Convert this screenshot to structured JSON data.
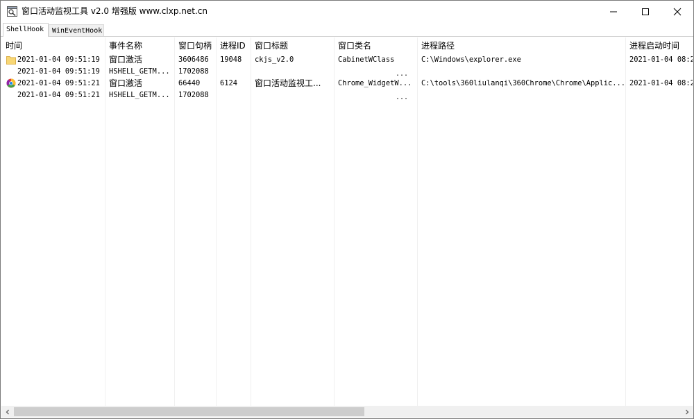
{
  "window": {
    "title": "窗口活动监视工具 v2.0 增强版 www.clxp.net.cn",
    "icon": "magnifier-window-icon"
  },
  "controls": {
    "minimize_icon": "minimize-icon",
    "maximize_icon": "maximize-icon",
    "close_icon": "close-icon"
  },
  "tabs": [
    {
      "label": "ShellHook",
      "active": true
    },
    {
      "label": "WinEventHook",
      "active": false
    }
  ],
  "table": {
    "columns": [
      "时间",
      "事件名称",
      "窗口句柄",
      "进程ID",
      "窗口标题",
      "窗口类名",
      "进程路径",
      "进程启动时间"
    ],
    "rows": [
      {
        "icon": "folder-icon",
        "time": "2021-01-04 09:51:19",
        "event": "窗口激活",
        "hwnd": "3606486",
        "pid": "19048",
        "title": "ckjs_v2.0",
        "class": "CabinetWClass",
        "path": "C:\\Windows\\explorer.exe",
        "start": "2021-01-04 08:2"
      },
      {
        "icon": "",
        "time": "2021-01-04 09:51:19",
        "event": "HSHELL_GETM...",
        "hwnd": "1702088",
        "pid": "",
        "title": "",
        "class": "",
        "path": "",
        "start": "",
        "dots": "..."
      },
      {
        "icon": "chrome-browser-icon",
        "time": "2021-01-04 09:51:21",
        "event": "窗口激活",
        "hwnd": "66440",
        "pid": "6124",
        "title": "窗口活动监视工...",
        "class": "Chrome_WidgetW...",
        "path": "C:\\tools\\360liulanqi\\360Chrome\\Chrome\\Applic...",
        "start": "2021-01-04 08:2"
      },
      {
        "icon": "",
        "time": "2021-01-04 09:51:21",
        "event": "HSHELL_GETM...",
        "hwnd": "1702088",
        "pid": "",
        "title": "",
        "class": "",
        "path": "",
        "start": "",
        "dots": "..."
      }
    ]
  },
  "scrollbar": {
    "left_icon": "scroll-left-arrow-icon",
    "right_icon": "scroll-right-arrow-icon",
    "thumb_fraction": 0.52
  }
}
